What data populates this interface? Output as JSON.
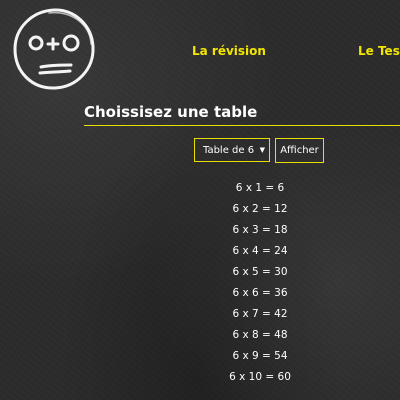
{
  "nav": {
    "revision_label": "La révision",
    "test_label": "Le Test"
  },
  "logo": {
    "icon": "chalk-face-logo"
  },
  "main": {
    "heading": "Choissisez une table",
    "select": {
      "selected": "Table de 6"
    },
    "show_button_label": "Afficher",
    "results": [
      "6 x 1 = 6",
      "6 x 2 = 12",
      "6 x 3 = 18",
      "6 x 4 = 24",
      "6 x 5 = 30",
      "6 x 6 = 36",
      "6 x 7 = 42",
      "6 x 8 = 48",
      "6 x 9 = 54",
      "6 x 10 = 60"
    ]
  },
  "colors": {
    "accent": "#e8de00",
    "nav_text": "#f2e600",
    "text": "#ffffff",
    "background": "#2c2c2c"
  }
}
